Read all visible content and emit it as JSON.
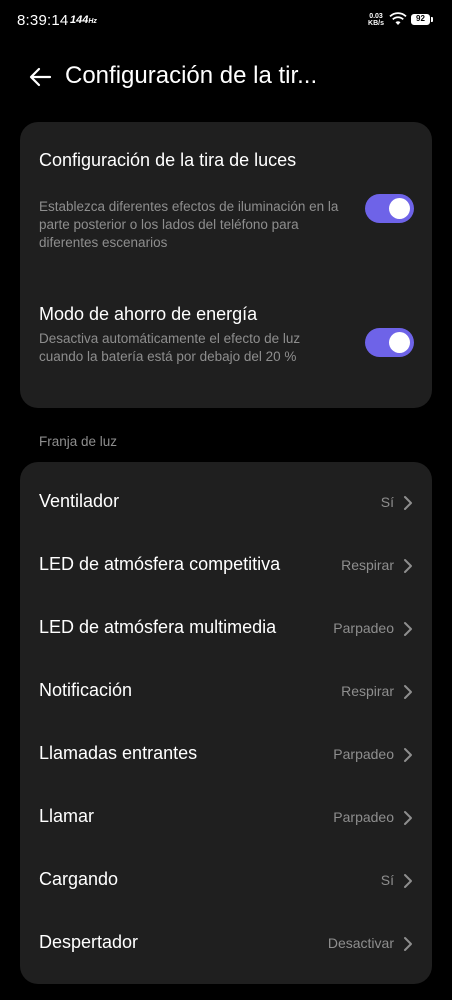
{
  "status_bar": {
    "time": "8:39:14",
    "refresh_rate": "144",
    "refresh_unit": "Hz",
    "net_speed_value": "0.03",
    "net_speed_unit": "KB/s",
    "battery": "92",
    "icons": [
      "wifi-icon",
      "battery-icon"
    ]
  },
  "header": {
    "title": "Configuración de la tir...",
    "back_icon": "arrow-left-icon"
  },
  "toggles": [
    {
      "title": "Configuración de la tira de luces",
      "description": "Establezca diferentes efectos de iluminación en la parte posterior o los lados del teléfono para diferentes escenarios",
      "enabled": true
    },
    {
      "title": "Modo de ahorro de energía",
      "description": "Desactiva automáticamente el efecto de luz cuando la batería está por debajo del 20 %",
      "enabled": true
    }
  ],
  "section": {
    "label": "Franja de luz"
  },
  "list_items": [
    {
      "label": "Ventilador",
      "value": "Sí"
    },
    {
      "label": "LED de atmósfera competitiva",
      "value": "Respirar"
    },
    {
      "label": "LED de atmósfera multimedia",
      "value": "Parpadeo"
    },
    {
      "label": "Notificación",
      "value": "Respirar"
    },
    {
      "label": "Llamadas entrantes",
      "value": "Parpadeo"
    },
    {
      "label": "Llamar",
      "value": "Parpadeo"
    },
    {
      "label": "Cargando",
      "value": "Sí"
    },
    {
      "label": "Despertador",
      "value": "Desactivar"
    }
  ],
  "colors": {
    "background": "#000000",
    "card": "#1f1f1f",
    "accent_toggle": "#6e63e8",
    "secondary_text": "#8e8e8e"
  }
}
